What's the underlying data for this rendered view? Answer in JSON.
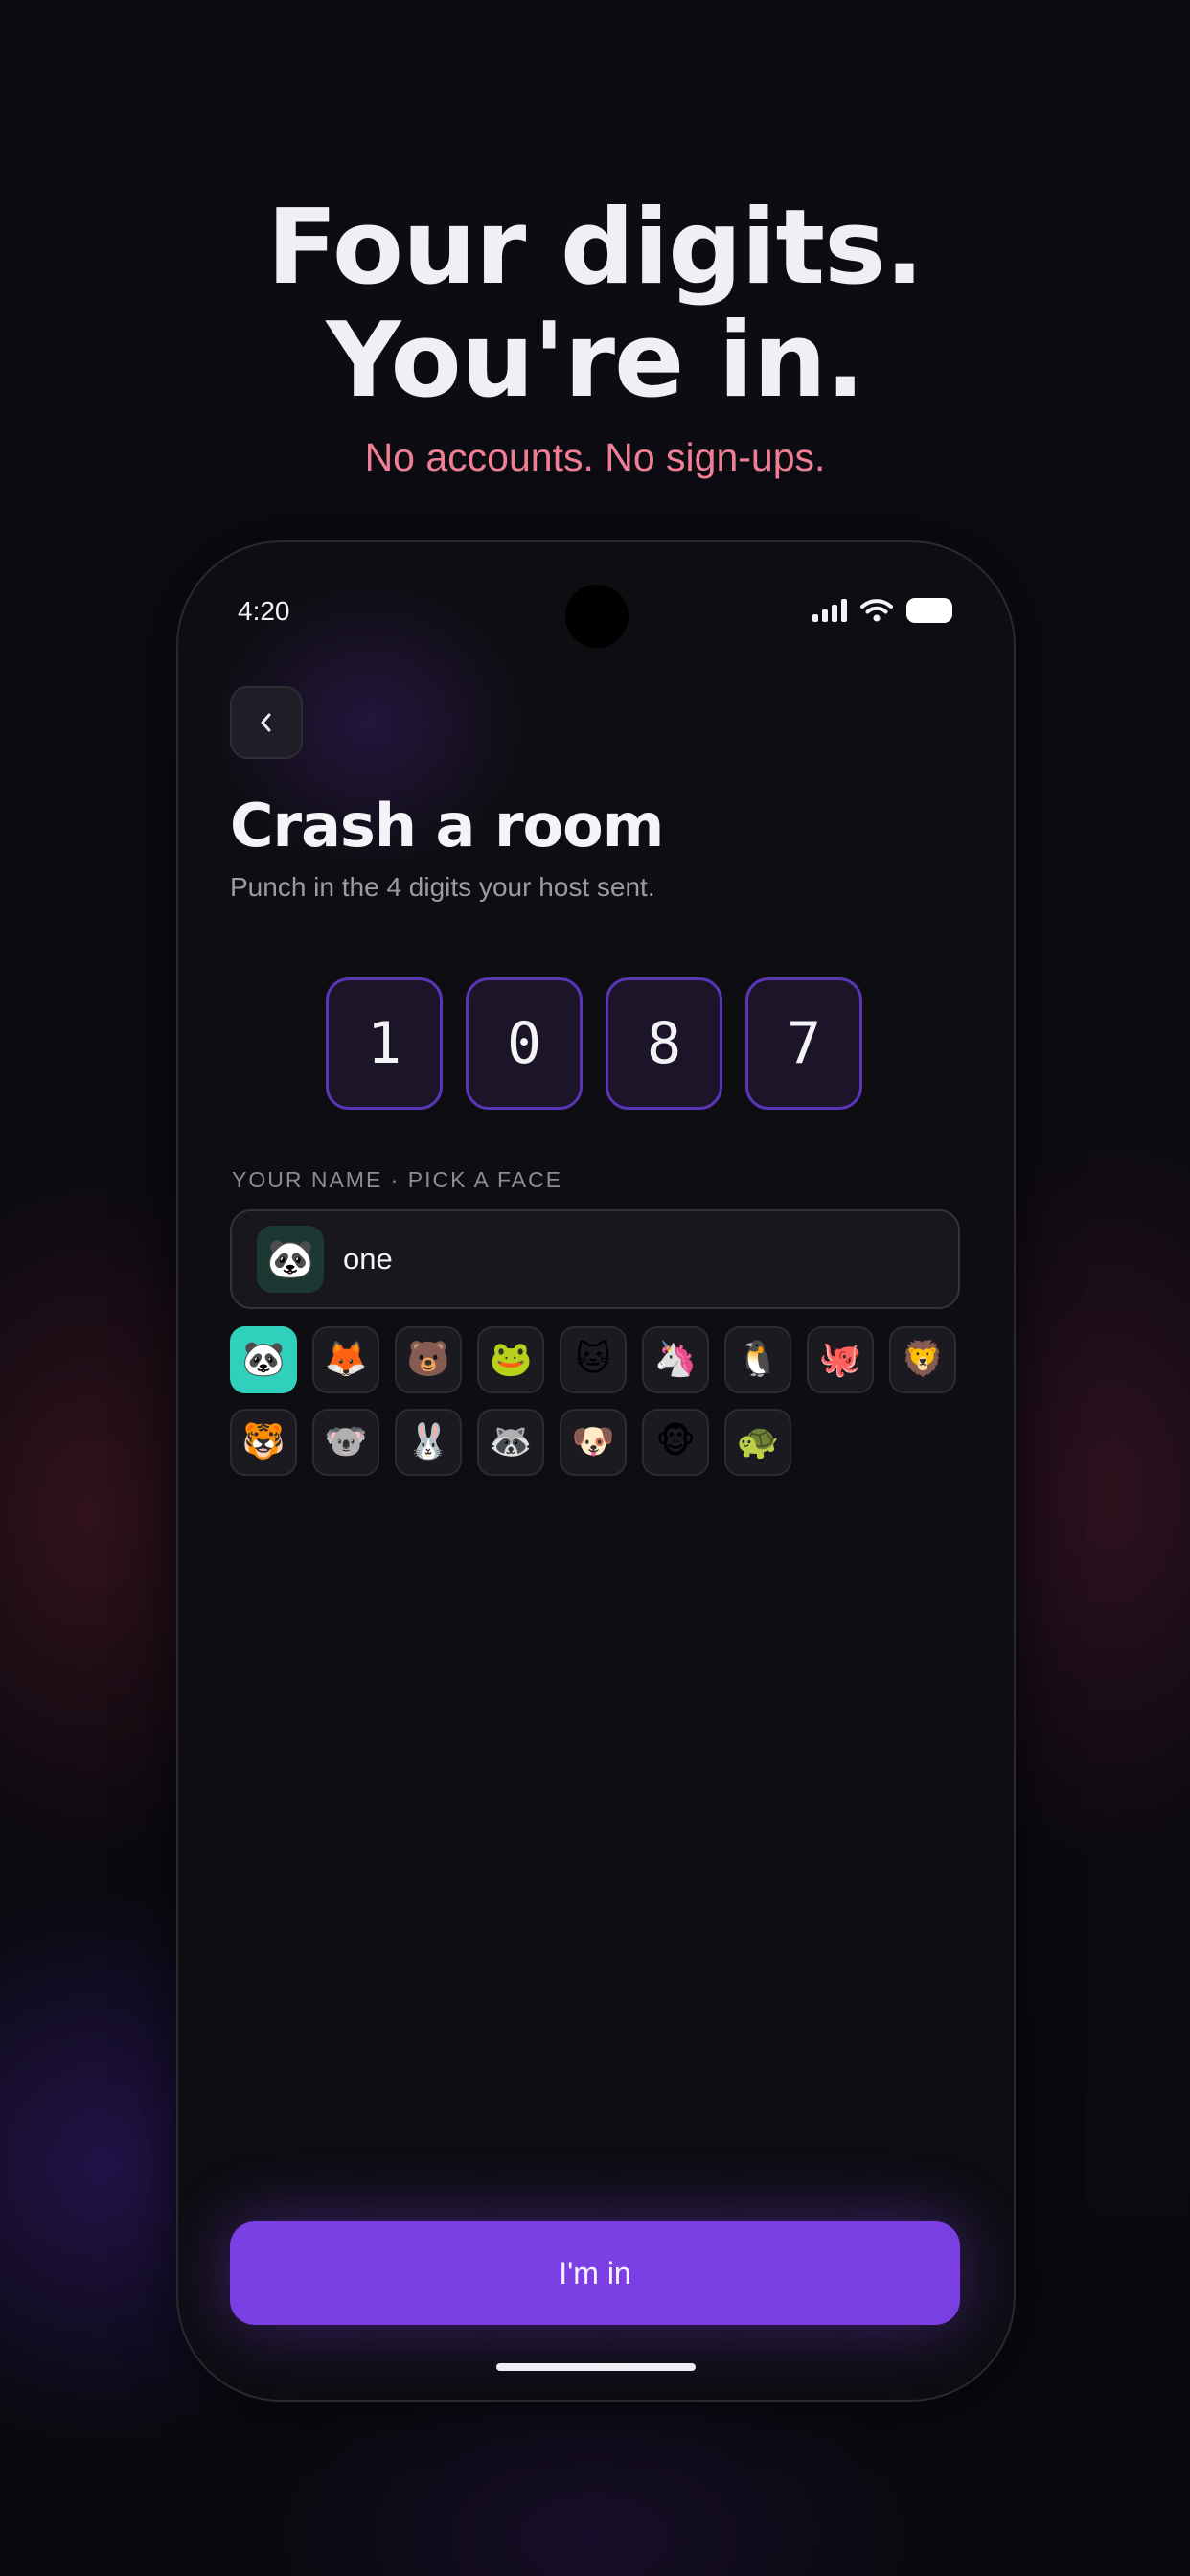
{
  "marketing": {
    "headline_line1": "Four digits.",
    "headline_line2": "You're in.",
    "tagline": "No accounts. No sign-ups."
  },
  "status_bar": {
    "time": "4:20",
    "icons": [
      "signal-icon",
      "wifi-icon",
      "battery-icon"
    ]
  },
  "screen": {
    "back_icon": "chevron-left-icon",
    "title": "Crash a room",
    "subtitle": "Punch in the 4 digits your host sent."
  },
  "code": {
    "digits": [
      "1",
      "0",
      "8",
      "7"
    ]
  },
  "name_section": {
    "label": "YOUR NAME · PICK A FACE",
    "selected_face": "🐼",
    "name_value": "one",
    "faces": [
      {
        "name": "panda",
        "emoji": "🐼",
        "selected": true
      },
      {
        "name": "fox",
        "emoji": "🦊",
        "selected": false
      },
      {
        "name": "bear",
        "emoji": "🐻",
        "selected": false
      },
      {
        "name": "frog",
        "emoji": "🐸",
        "selected": false
      },
      {
        "name": "cat",
        "emoji": "🐱",
        "selected": false
      },
      {
        "name": "unicorn",
        "emoji": "🦄",
        "selected": false
      },
      {
        "name": "penguin",
        "emoji": "🐧",
        "selected": false
      },
      {
        "name": "octopus",
        "emoji": "🐙",
        "selected": false
      },
      {
        "name": "lion",
        "emoji": "🦁",
        "selected": false
      },
      {
        "name": "tiger",
        "emoji": "🐯",
        "selected": false
      },
      {
        "name": "koala",
        "emoji": "🐨",
        "selected": false
      },
      {
        "name": "rabbit",
        "emoji": "🐰",
        "selected": false
      },
      {
        "name": "raccoon",
        "emoji": "🦝",
        "selected": false
      },
      {
        "name": "dog",
        "emoji": "🐶",
        "selected": false
      },
      {
        "name": "monkey",
        "emoji": "🐵",
        "selected": false
      },
      {
        "name": "turtle",
        "emoji": "🐢",
        "selected": false
      }
    ]
  },
  "actions": {
    "submit_label": "I'm in"
  },
  "colors": {
    "accent": "#7b3fe4",
    "selected_face_bg": "#2fd1bd",
    "tagline": "#f07f95",
    "digit_border": "#5b35b8"
  }
}
